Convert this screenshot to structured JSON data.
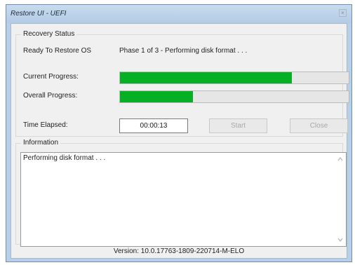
{
  "window": {
    "title": "Restore UI - UEFI",
    "close_glyph": "×"
  },
  "recovery_status": {
    "group_label": "Recovery Status",
    "status_label": "Ready To Restore OS",
    "phase_text": "Phase 1 of 3 - Performing disk format . . .",
    "current_progress_label": "Current Progress:",
    "current_progress_percent": 75,
    "overall_progress_label": "Overall Progress:",
    "overall_progress_percent": 32,
    "time_elapsed_label": "Time Elapsed:",
    "time_elapsed_value": "00:00:13",
    "start_button": "Start",
    "close_button": "Close"
  },
  "information": {
    "group_label": "Information",
    "text": "Performing disk format . . ."
  },
  "footer": {
    "version": "Version: 10.0.17763-1809-220714-M-ELO"
  },
  "colors": {
    "progress_fill": "#06b025",
    "window_frame": "#b9cfe6",
    "client_bg": "#f0f0f0",
    "disabled_text": "#a8a8a8"
  },
  "icons": {
    "scroll_up": "chevron-up-icon",
    "scroll_down": "chevron-down-icon"
  }
}
